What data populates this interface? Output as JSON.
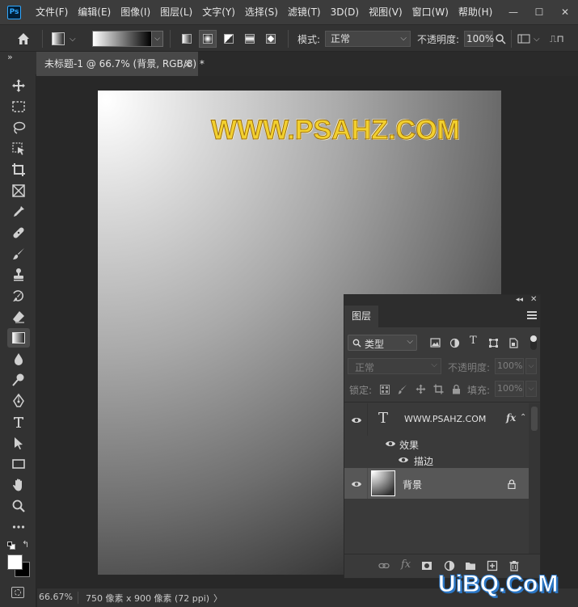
{
  "app": {
    "logo": "Ps"
  },
  "menu": [
    "文件(F)",
    "编辑(E)",
    "图像(I)",
    "图层(L)",
    "文字(Y)",
    "选择(S)",
    "滤镜(T)",
    "3D(D)",
    "视图(V)",
    "窗口(W)",
    "帮助(H)"
  ],
  "window_controls": {
    "minimize": "—",
    "restore": "☐",
    "close": "✕"
  },
  "options": {
    "home_icon": "home-icon",
    "mode_label": "模式:",
    "mode_value": "正常",
    "opacity_label": "不透明度:",
    "opacity_value": "100%"
  },
  "toolbar": {
    "expand": "»",
    "tools": [
      "move-icon",
      "marquee-icon",
      "lasso-icon",
      "object-select-icon",
      "crop-icon",
      "frame-icon",
      "eyedropper-icon",
      "healing-icon",
      "brush-icon",
      "stamp-icon",
      "history-brush-icon",
      "eraser-icon",
      "gradient-icon",
      "blur-icon",
      "dodge-icon",
      "pen-icon",
      "type-icon",
      "path-select-icon",
      "rectangle-icon",
      "hand-icon",
      "zoom-icon",
      "more-icon"
    ],
    "active_tool": "gradient-icon"
  },
  "document": {
    "tab_title": "未标题-1 @ 66.7% (背景, RGB/8) *",
    "close": "×",
    "canvas_text": "WWW.PSAHZ.COM"
  },
  "status": {
    "zoom": "66.67%",
    "info": "750 像素 x 900 像素 (72 ppi)",
    "arrow": "〉"
  },
  "layers_panel": {
    "tab": "图层",
    "filter_label": "类型",
    "blend_mode": "正常",
    "opacity_label": "不透明度:",
    "opacity_value": "100%",
    "lock_label": "锁定:",
    "fill_label": "填充:",
    "fill_value": "100%",
    "layers": [
      {
        "name": "WWW.PSAHZ.COM",
        "type": "text",
        "fx": "fx",
        "effects_label": "效果",
        "effect_item": "描边"
      },
      {
        "name": "背景",
        "type": "background",
        "locked": true
      }
    ],
    "footer_icons": [
      "link-icon",
      "fx-icon",
      "mask-icon",
      "adjustment-icon",
      "group-icon",
      "new-layer-icon",
      "delete-icon"
    ]
  },
  "watermark": "UiBQ.CoM"
}
